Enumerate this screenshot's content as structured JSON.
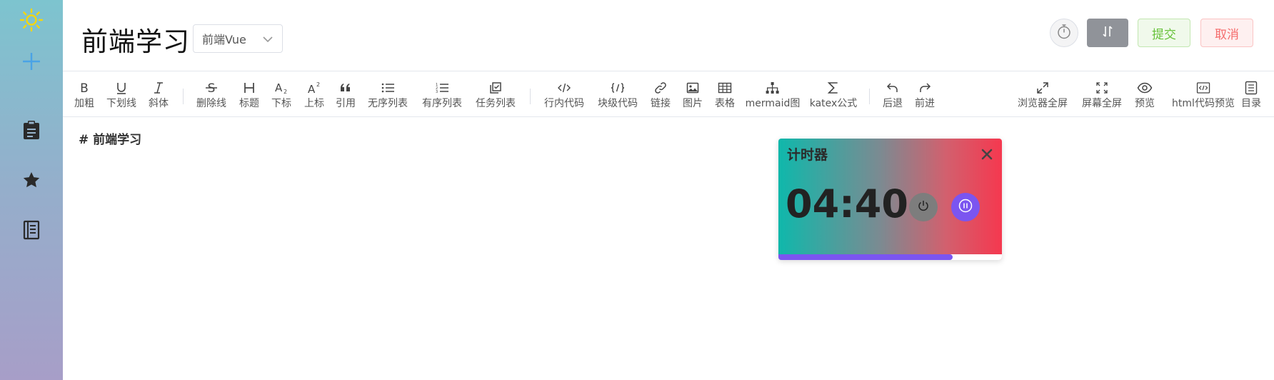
{
  "app": {
    "sidebar": {
      "items": [
        {
          "icon": "sun-icon"
        },
        {
          "icon": "plus-icon"
        },
        {
          "icon": "clipboard-icon"
        },
        {
          "icon": "star-icon"
        },
        {
          "icon": "notebook-icon"
        }
      ]
    },
    "header": {
      "title": "前端学习",
      "category_select": {
        "value": "前端Vue"
      },
      "submit_label": "提交",
      "cancel_label": "取消"
    },
    "toolbar": {
      "groups": [
        [
          {
            "label": "加粗",
            "icon": "bold-icon"
          },
          {
            "label": "下划线",
            "icon": "underline-icon"
          },
          {
            "label": "斜体",
            "icon": "italic-icon"
          }
        ],
        [
          {
            "label": "删除线",
            "icon": "strikethrough-icon"
          },
          {
            "label": "标题",
            "icon": "heading-icon"
          },
          {
            "label": "下标",
            "icon": "subscript-icon"
          },
          {
            "label": "上标",
            "icon": "superscript-icon"
          },
          {
            "label": "引用",
            "icon": "quote-icon"
          },
          {
            "label": "无序列表",
            "icon": "unordered-list-icon"
          },
          {
            "label": "有序列表",
            "icon": "ordered-list-icon"
          },
          {
            "label": "任务列表",
            "icon": "task-list-icon"
          }
        ],
        [
          {
            "label": "行内代码",
            "icon": "inline-code-icon"
          },
          {
            "label": "块级代码",
            "icon": "code-block-icon"
          },
          {
            "label": "链接",
            "icon": "link-icon"
          },
          {
            "label": "图片",
            "icon": "image-icon"
          },
          {
            "label": "表格",
            "icon": "table-icon"
          },
          {
            "label": "mermaid图",
            "icon": "mermaid-icon"
          },
          {
            "label": "katex公式",
            "icon": "sigma-icon"
          }
        ],
        [
          {
            "label": "后退",
            "icon": "undo-icon"
          },
          {
            "label": "前进",
            "icon": "redo-icon"
          }
        ],
        [
          {
            "label": "浏览器全屏",
            "icon": "browser-fullscreen-icon"
          },
          {
            "label": "屏幕全屏",
            "icon": "screen-fullscreen-icon"
          },
          {
            "label": "预览",
            "icon": "eye-icon"
          },
          {
            "label": "html代码预览",
            "icon": "html-preview-icon"
          },
          {
            "label": "目录",
            "icon": "catalog-icon"
          }
        ]
      ]
    },
    "editor": {
      "content_line": "#  前端学习"
    },
    "timer": {
      "title": "计时器",
      "time": "04:40",
      "progress": 0.78
    },
    "colors": {
      "accent_purple": "#7b55f0",
      "submit_green": "#67c23a",
      "cancel_red": "#f56c6c",
      "switch_gray": "#909399",
      "sun_yellow": "#f5d60c",
      "plus_blue": "#4aa3e6"
    }
  }
}
